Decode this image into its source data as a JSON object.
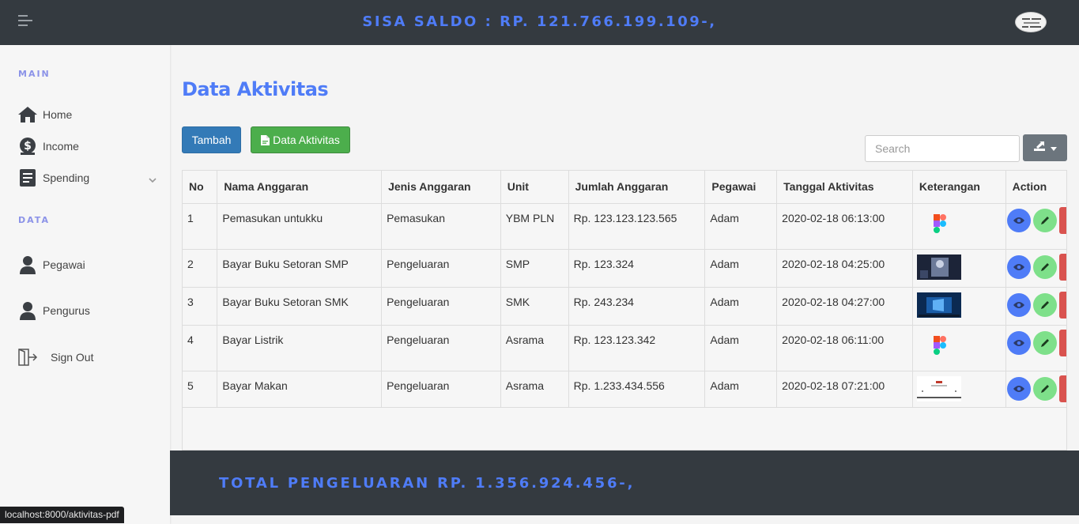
{
  "header": {
    "saldo": "SISA SALDO : RP. 121.766.199.109-,",
    "menu_icon": "hamburger-icon",
    "avatar_icon": "avatar"
  },
  "sidebar": {
    "section_main": "MAIN",
    "section_data": "DATA",
    "items": [
      {
        "label": "Home",
        "icon": "home-icon"
      },
      {
        "label": "Income",
        "icon": "dollar-icon"
      },
      {
        "label": "Spending",
        "icon": "book-icon"
      },
      {
        "label": "Pegawai",
        "icon": "user-icon"
      },
      {
        "label": "Pengurus",
        "icon": "user-icon"
      },
      {
        "label": "Sign Out",
        "icon": "sign-out-icon"
      }
    ]
  },
  "main": {
    "title": "Data Aktivitas",
    "add_button": "Tambah",
    "pdf_button": "Data Aktivitas",
    "search_placeholder": "Search"
  },
  "table": {
    "columns": [
      "No",
      "Nama Anggaran",
      "Jenis Anggaran",
      "Unit",
      "Jumlah Anggaran",
      "Pegawai",
      "Tanggal Aktivitas",
      "Keterangan",
      "Action"
    ],
    "rows": [
      {
        "no": "1",
        "nama": "Pemasukan untukku",
        "jenis": "Pemasukan",
        "unit": "YBM PLN",
        "jumlah": "Rp. 123.123.123.565",
        "pegawai": "Adam",
        "tanggal": "2020-02-18 06:13:00",
        "keterangan": "figma-logo"
      },
      {
        "no": "2",
        "nama": "Bayar Buku Setoran SMP",
        "jenis": "Pengeluaran",
        "unit": "SMP",
        "jumlah": "Rp. 123.324",
        "pegawai": "Adam",
        "tanggal": "2020-02-18 04:25:00",
        "keterangan": "dark-photo"
      },
      {
        "no": "3",
        "nama": "Bayar Buku Setoran SMK",
        "jenis": "Pengeluaran",
        "unit": "SMK",
        "jumlah": "Rp. 243.234",
        "pegawai": "Adam",
        "tanggal": "2020-02-18 04:27:00",
        "keterangan": "windows-wallpaper"
      },
      {
        "no": "4",
        "nama": "Bayar Listrik",
        "jenis": "Pengeluaran",
        "unit": "Asrama",
        "jumlah": "Rp. 123.123.342",
        "pegawai": "Adam",
        "tanggal": "2020-02-18 06:11:00",
        "keterangan": "figma-logo"
      },
      {
        "no": "5",
        "nama": "Bayar Makan",
        "jenis": "Pengeluaran",
        "unit": "Asrama",
        "jumlah": "Rp. 1.233.434.556",
        "pegawai": "Adam",
        "tanggal": "2020-02-18 07:21:00",
        "keterangan": "document-screenshot"
      }
    ]
  },
  "footer": {
    "total": "TOTAL PENGELUARAN RP. 1.356.924.456-,"
  },
  "statusbar": {
    "url": "localhost:8000/aktivitas-pdf"
  },
  "colors": {
    "accent": "#4f7cf7",
    "header_bg": "#343a40",
    "btn_primary": "#337ab7",
    "btn_success": "#4cae4c",
    "btn_view": "#4f7cf7",
    "btn_edit": "#7ee08a",
    "btn_delete": "#d9534f"
  }
}
